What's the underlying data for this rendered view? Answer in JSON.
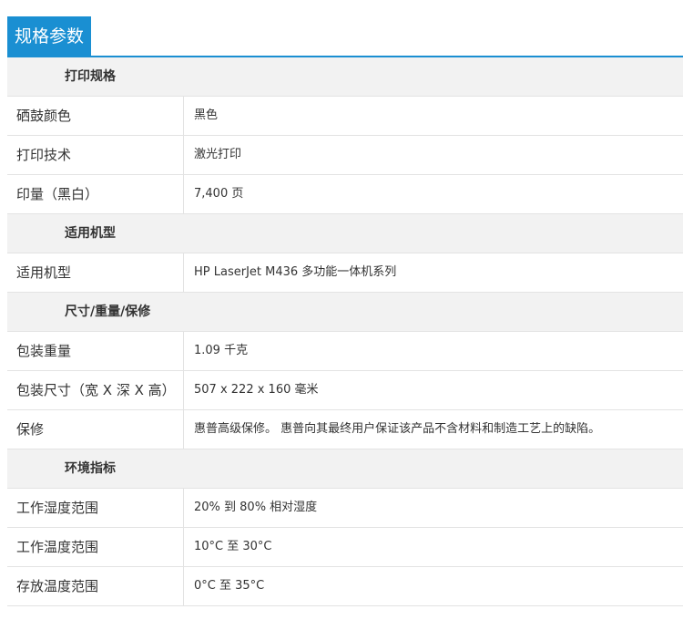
{
  "header": {
    "title": "规格参数",
    "accent_color": "#1a8fd2"
  },
  "sections": [
    {
      "title": "打印规格",
      "rows": [
        {
          "label": "硒鼓颜色",
          "value": "黑色"
        },
        {
          "label": "打印技术",
          "value": "激光打印"
        },
        {
          "label": "印量（黑白）",
          "value": "7,400 页"
        }
      ]
    },
    {
      "title": "适用机型",
      "rows": [
        {
          "label": "适用机型",
          "value": "HP LaserJet M436 多功能一体机系列"
        }
      ]
    },
    {
      "title": "尺寸/重量/保修",
      "rows": [
        {
          "label": "包装重量",
          "value": "1.09 千克"
        },
        {
          "label": "包装尺寸（宽 X 深 X 高）",
          "value": "507 x 222 x 160 毫米"
        },
        {
          "label": "保修",
          "value": "惠普高级保修。 惠普向其最终用户保证该产品不含材料和制造工艺上的缺陷。"
        }
      ]
    },
    {
      "title": "环境指标",
      "rows": [
        {
          "label": "工作湿度范围",
          "value": "20% 到 80% 相对湿度"
        },
        {
          "label": "工作温度范围",
          "value": "10°C 至 30°C"
        },
        {
          "label": "存放温度范围",
          "value": "0°C 至 35°C"
        }
      ]
    }
  ]
}
